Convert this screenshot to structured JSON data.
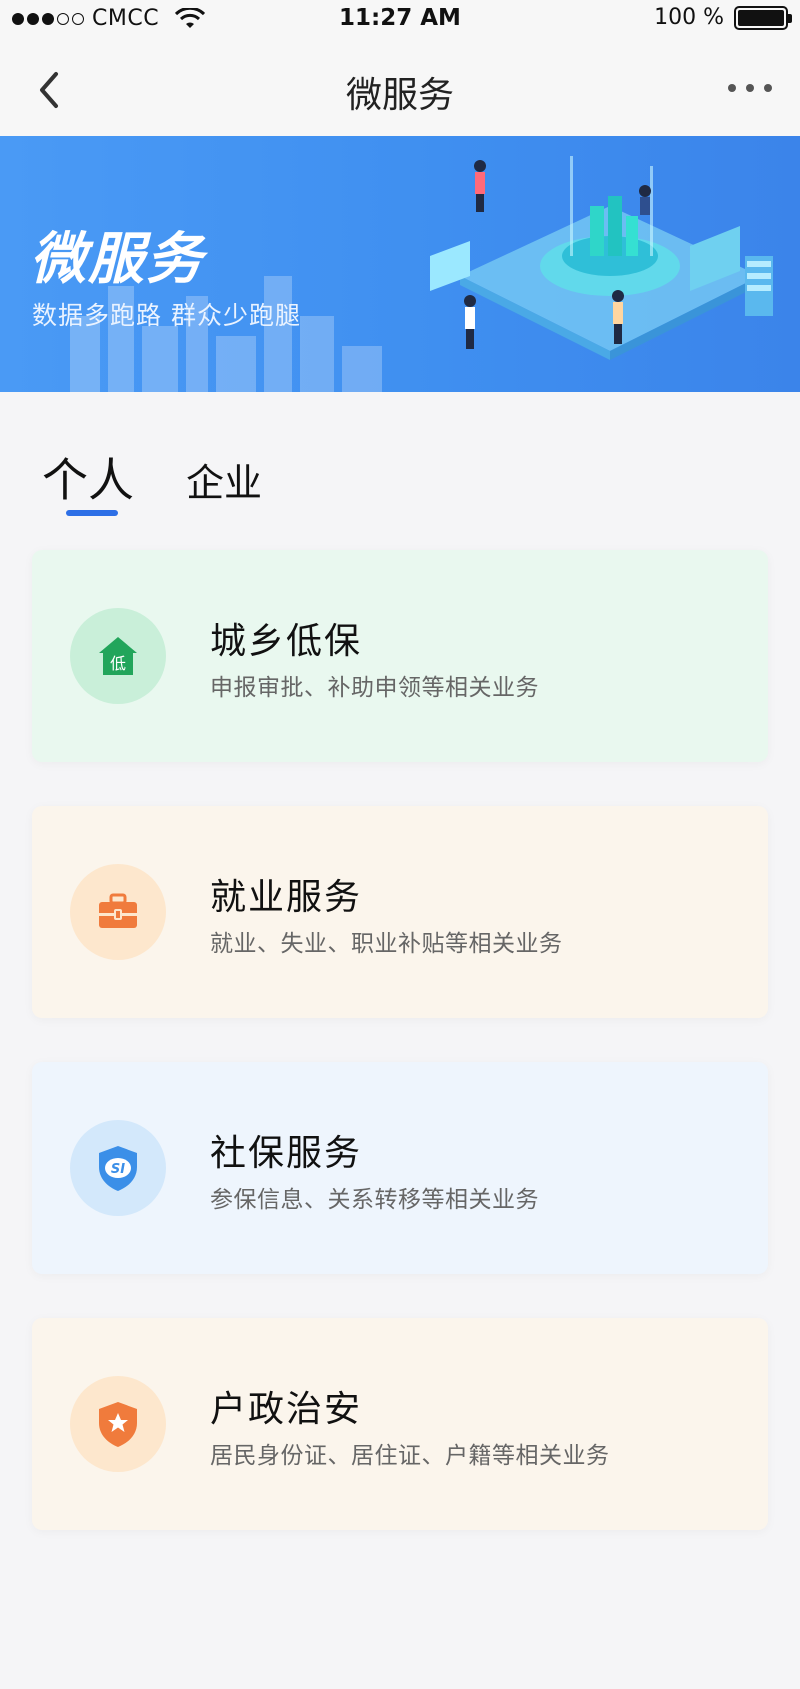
{
  "status_bar": {
    "carrier": "CMCC",
    "time": "11:27 AM",
    "battery": "100 %",
    "battery_level": 1.0,
    "signal_bars_filled": 3,
    "signal_bars_total": 5
  },
  "nav": {
    "title": "微服务",
    "back_icon": "chevron-left-icon",
    "more_icon": "more-dots-icon"
  },
  "banner": {
    "title": "微服务",
    "subtitle": "数据多跑路  群众少跑腿",
    "gradient_colors": [
      "#4a9af5",
      "#3b84ea"
    ]
  },
  "tabs": [
    {
      "label": "个人",
      "active": true
    },
    {
      "label": "企业",
      "active": false
    }
  ],
  "accent_color": "#2d6fe6",
  "services": [
    {
      "title": "城乡低保",
      "description": "申报审批、补助申领等相关业务",
      "icon": "house-icon",
      "icon_text": "低",
      "icon_color": "#22a55b",
      "bg": "#e9f8ef"
    },
    {
      "title": "就业服务",
      "description": "就业、失业、职业补贴等相关业务",
      "icon": "briefcase-icon",
      "icon_color": "#f07b3c",
      "bg": "#fbf5ec"
    },
    {
      "title": "社保服务",
      "description": "参保信息、关系转移等相关业务",
      "icon": "shield-icon",
      "icon_text": "SI",
      "icon_color": "#3b8fe8",
      "bg": "#eef5fd"
    },
    {
      "title": "户政治安",
      "description": "居民身份证、居住证、户籍等相关业务",
      "icon": "police-badge-icon",
      "icon_color": "#f07b3c",
      "bg": "#fbf5ec"
    }
  ]
}
